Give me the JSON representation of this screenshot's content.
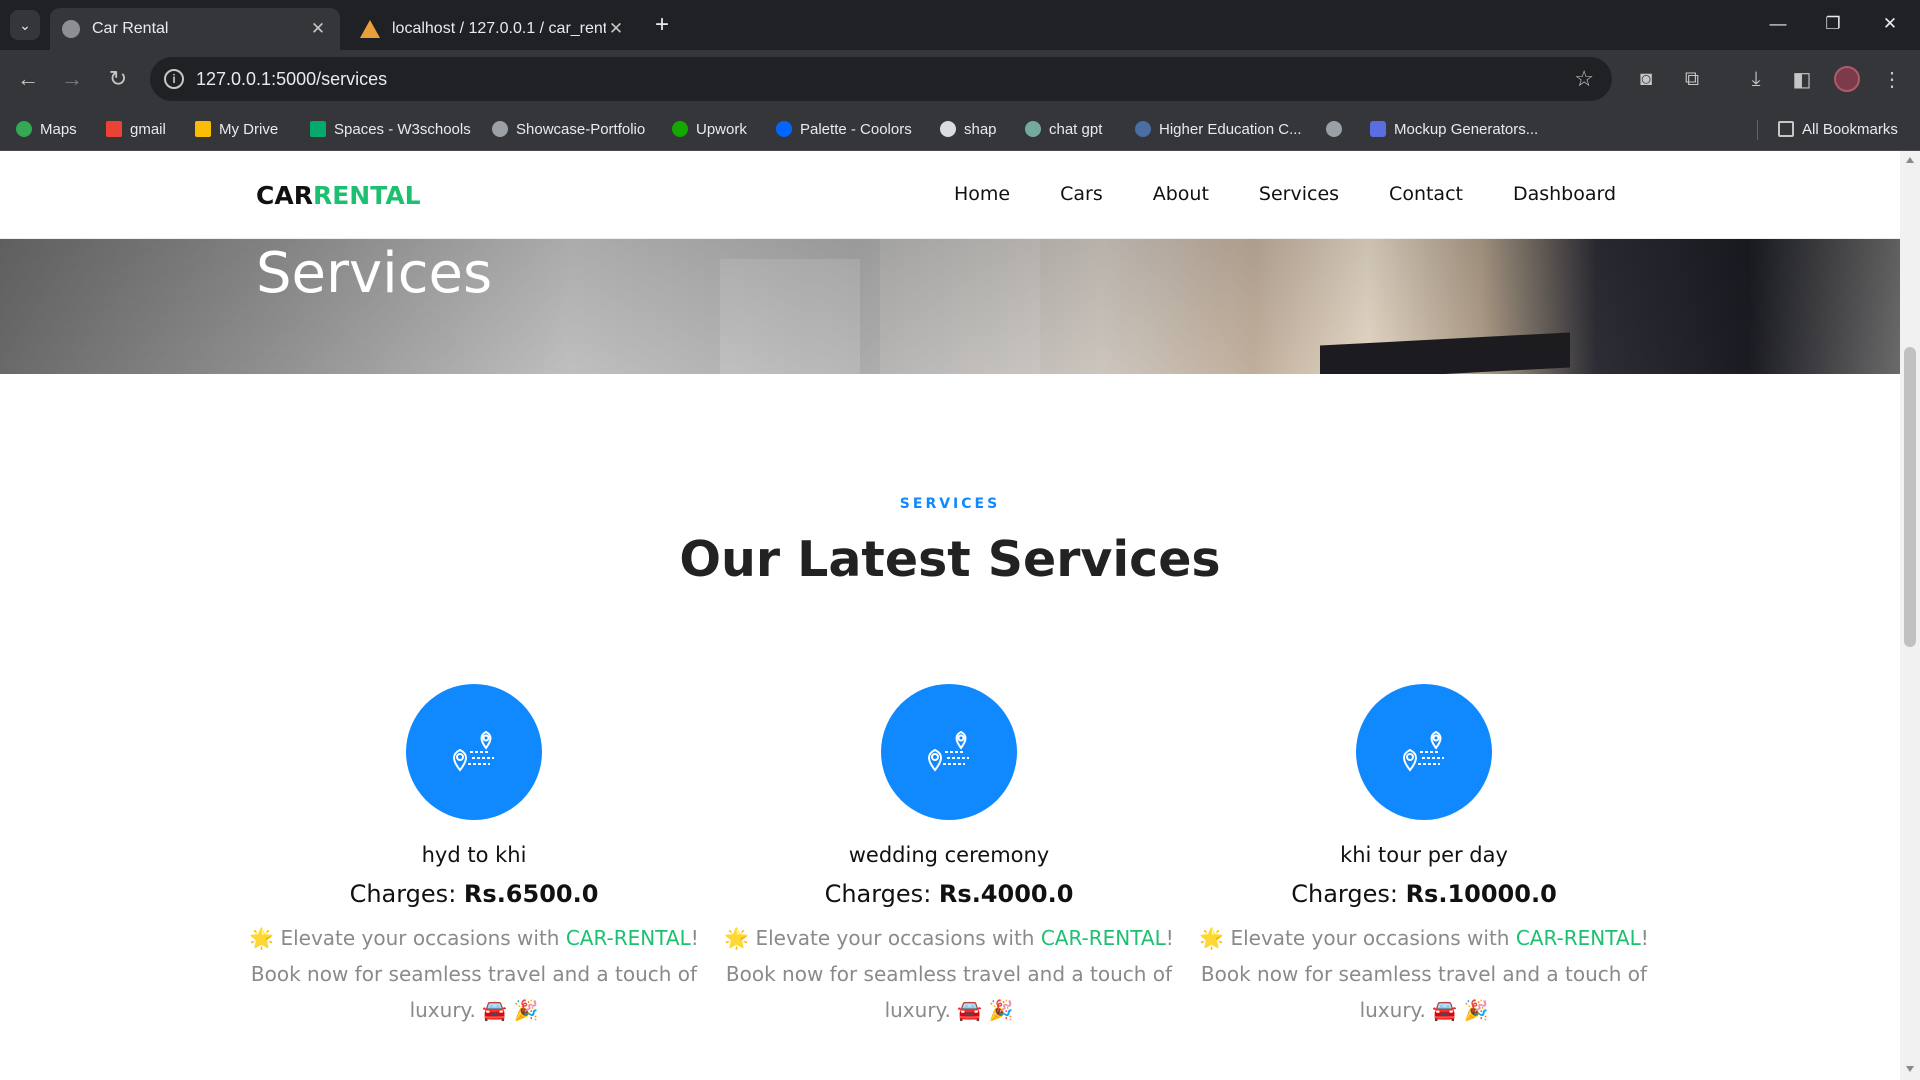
{
  "browser": {
    "tabs": [
      {
        "title": "Car Rental",
        "active": true
      },
      {
        "title": "localhost / 127.0.0.1 / car_rental",
        "active": false
      }
    ],
    "url": "127.0.0.1:5000/services",
    "bookmarks": [
      "Maps",
      "gmail",
      "My Drive",
      "Spaces - W3schools",
      "Showcase-Portfolio",
      "Upwork",
      "Palette - Coolors",
      "shap",
      "chat gpt",
      "Higher Education C...",
      "",
      "Mockup Generators..."
    ],
    "all_bookmarks": "All Bookmarks"
  },
  "site": {
    "logo_part1": "CAR",
    "logo_part2": "RENTAL",
    "nav": [
      "Home",
      "Cars",
      "About",
      "Services",
      "Contact",
      "Dashboard"
    ],
    "hero_title": "Services",
    "eyebrow": "SERVICES",
    "section_title": "Our Latest Services",
    "charges_label": "Charges:",
    "services": [
      {
        "name": "hyd to khi",
        "price": "Rs.6500.0"
      },
      {
        "name": "wedding ceremony",
        "price": "Rs.4000.0"
      },
      {
        "name": "khi tour per day",
        "price": "Rs.10000.0"
      }
    ],
    "desc_prefix": "🌟 Elevate your occasions with ",
    "desc_brand": "CAR-RENTAL",
    "desc_suffix": "! Book now for seamless travel and a touch of luxury. 🚘 🎉"
  },
  "colors": {
    "accent": "#1089ff",
    "brand_green": "#1dc070"
  },
  "icons": [
    "route-pin-icon"
  ]
}
